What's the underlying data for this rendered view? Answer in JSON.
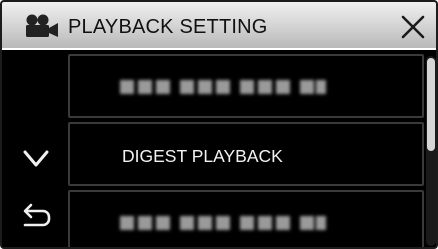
{
  "header": {
    "title": "PLAYBACK SETTING",
    "mode_icon": "movie-camera-icon",
    "close_icon": "close-x-icon"
  },
  "menu": {
    "items": [
      {
        "label": "",
        "blurred": true
      },
      {
        "label": "DIGEST PLAYBACK",
        "blurred": false
      },
      {
        "label": "",
        "blurred": true
      }
    ]
  },
  "controls": {
    "down_icon": "chevron-down-icon",
    "back_icon": "return-arrow-icon"
  },
  "scrollbar": {
    "position_fraction": 0.0,
    "visible_fraction": 0.5
  },
  "colors": {
    "screen_bg": "#000000",
    "header_bg": "#d2d2d2",
    "item_border": "#3a3a3a",
    "text_light": "#f2f2f2"
  }
}
